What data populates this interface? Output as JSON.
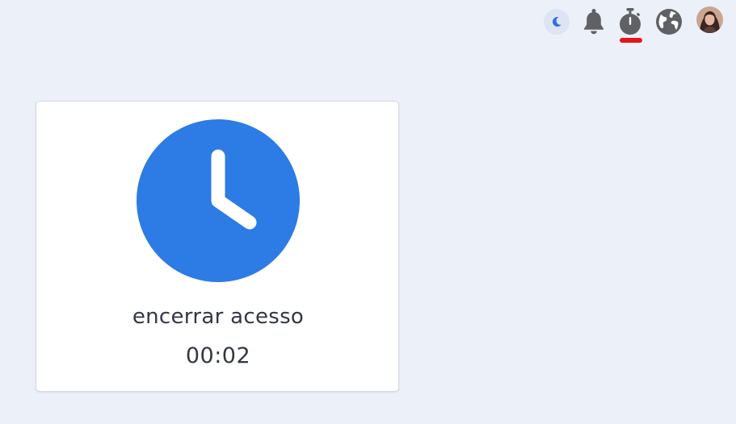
{
  "topbar": {
    "icons": {
      "theme": "moon-icon",
      "notifications": "bell-icon",
      "timer": "stopwatch-icon",
      "language": "globe-icon",
      "profile": "avatar"
    },
    "active_indicator_color": "#e8141b"
  },
  "card": {
    "icon": "clock-icon",
    "accent_color": "#2d7be4",
    "title": "encerrar acesso",
    "time": "00:02"
  }
}
